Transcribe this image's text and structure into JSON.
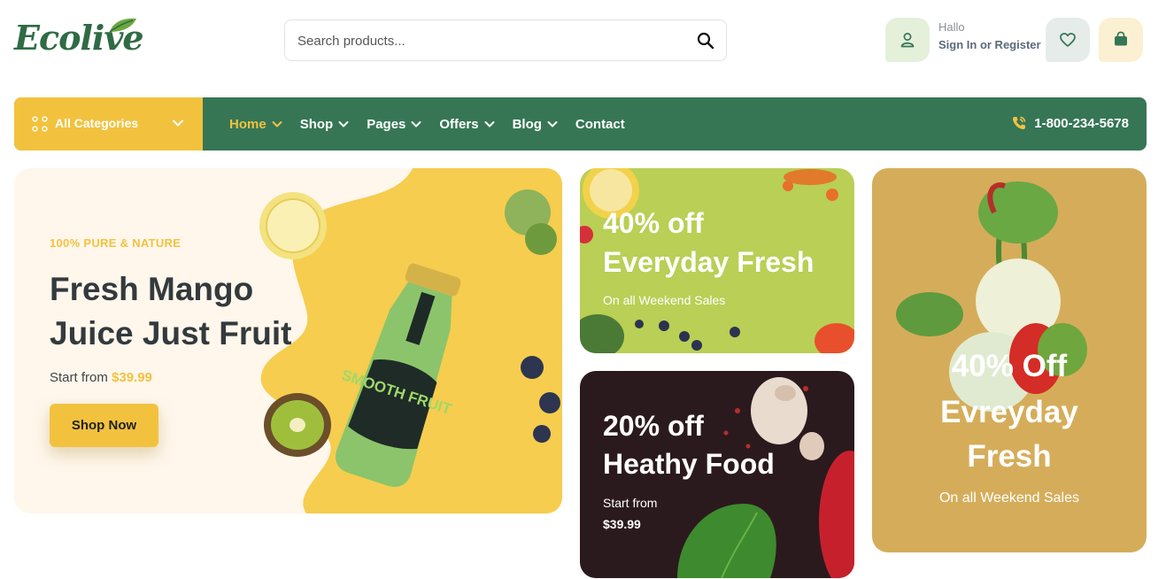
{
  "brand": {
    "name": "Ecolive"
  },
  "search": {
    "placeholder": "Search products..."
  },
  "account": {
    "greeting": "Hallo",
    "link": "Sign In or Register"
  },
  "categories": {
    "label": "All Categories"
  },
  "nav": {
    "items": [
      {
        "label": "Home",
        "active": true,
        "has_dropdown": true
      },
      {
        "label": "Shop",
        "has_dropdown": true
      },
      {
        "label": "Pages",
        "has_dropdown": true
      },
      {
        "label": "Offers",
        "has_dropdown": true
      },
      {
        "label": "Blog",
        "has_dropdown": true
      },
      {
        "label": "Contact",
        "has_dropdown": false
      }
    ],
    "phone": "1-800-234-5678"
  },
  "hero": {
    "tag": "100% PURE & NATURE",
    "title": "Fresh Mango Juice Just Fruit",
    "price_prefix": "Start from ",
    "price": "$39.99",
    "button": "Shop Now",
    "bottle_text": "SMOOTH FRUIT"
  },
  "promos": [
    {
      "line1": "40% off",
      "line2": "Everyday Fresh",
      "sub": "On all Weekend Sales"
    },
    {
      "line1": "20% off",
      "line2": "Heathy Food",
      "sub_line1": "Start from",
      "sub_line2": "$39.99"
    },
    {
      "line1": "40% Off",
      "line2": "Evreyday",
      "line3": "Fresh",
      "sub": "On all Weekend Sales"
    }
  ],
  "colors": {
    "primary_green": "#367655",
    "accent_yellow": "#f2c23f",
    "promo_green": "#b9cf55",
    "promo_dark": "#2b1a1d",
    "promo_gold": "#d5ad5a"
  }
}
